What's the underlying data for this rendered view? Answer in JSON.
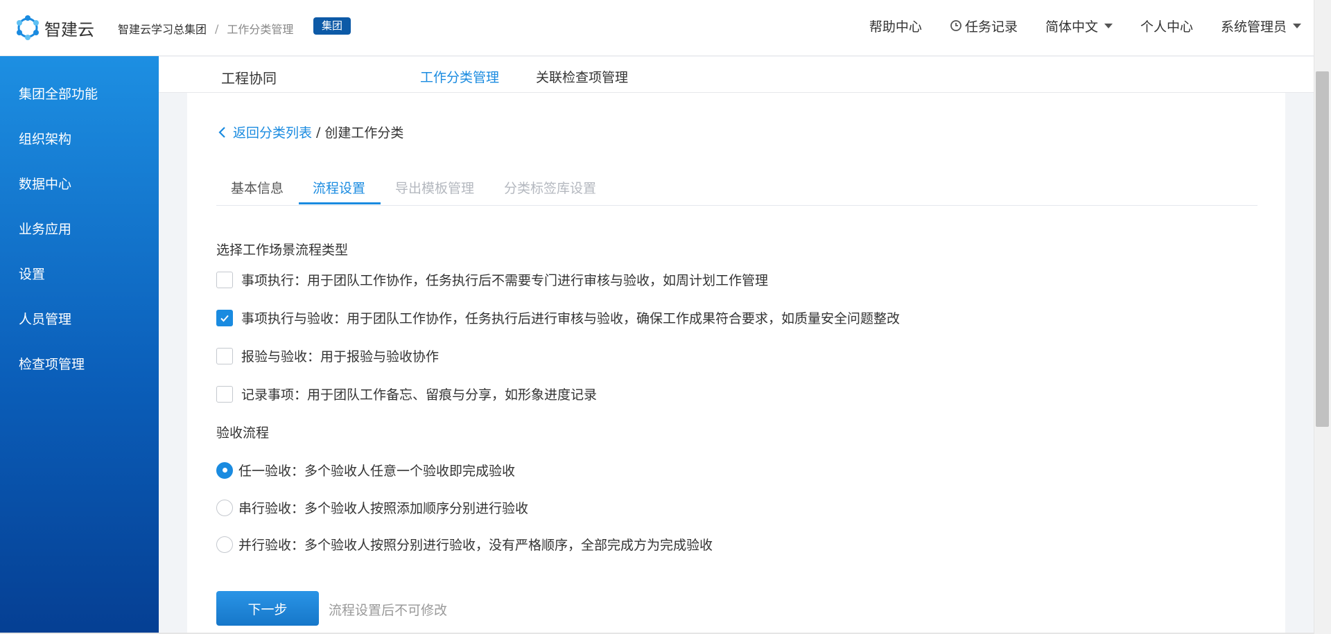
{
  "app": {
    "logo_text": "智建云",
    "breadcrumb_group": "智建云学习总集团",
    "breadcrumb_sep": "/",
    "breadcrumb_page": "工作分类管理",
    "badge": "集团"
  },
  "header_nav": {
    "help": "帮助中心",
    "tasks": "任务记录",
    "language": "简体中文",
    "profile": "个人中心",
    "admin": "系统管理员"
  },
  "sidebar": {
    "items": [
      {
        "label": "集团全部功能"
      },
      {
        "label": "组织架构"
      },
      {
        "label": "数据中心"
      },
      {
        "label": "业务应用"
      },
      {
        "label": "设置"
      },
      {
        "label": "人员管理"
      },
      {
        "label": "检查项管理"
      }
    ]
  },
  "subnav": {
    "title": "工程协同",
    "links": [
      {
        "label": "工作分类管理",
        "active": true
      },
      {
        "label": "关联检查项管理",
        "active": false
      }
    ]
  },
  "page": {
    "back_label": "返回分类列表",
    "sep": "/",
    "current": "创建工作分类"
  },
  "tabs": [
    {
      "label": "基本信息",
      "state": "normal"
    },
    {
      "label": "流程设置",
      "state": "active"
    },
    {
      "label": "导出模板管理",
      "state": "disabled"
    },
    {
      "label": "分类标签库设置",
      "state": "disabled"
    }
  ],
  "flow_type": {
    "label": "选择工作场景流程类型",
    "options": [
      {
        "text": "事项执行：用于团队工作协作，任务执行后不需要专门进行审核与验收，如周计划工作管理",
        "checked": false
      },
      {
        "text": "事项执行与验收：用于团队工作协作，任务执行后进行审核与验收，确保工作成果符合要求，如质量安全问题整改",
        "checked": true
      },
      {
        "text": "报验与验收：用于报验与验收协作",
        "checked": false
      },
      {
        "text": "记录事项：用于团队工作备忘、留痕与分享，如形象进度记录",
        "checked": false
      }
    ]
  },
  "acceptance": {
    "label": "验收流程",
    "options": [
      {
        "text": "任一验收：多个验收人任意一个验收即完成验收",
        "selected": true
      },
      {
        "text": "串行验收：多个验收人按照添加顺序分别进行验收",
        "selected": false
      },
      {
        "text": "并行验收：多个验收人按照分别进行验收，没有严格顺序，全部完成方为完成验收",
        "selected": false
      }
    ]
  },
  "actions": {
    "next": "下一步",
    "hint": "流程设置后不可修改"
  },
  "colors": {
    "accent": "#1a8be0",
    "badge": "#0d5aa7",
    "sidebar_top": "#1d8fe2",
    "sidebar_bottom": "#053f93"
  }
}
